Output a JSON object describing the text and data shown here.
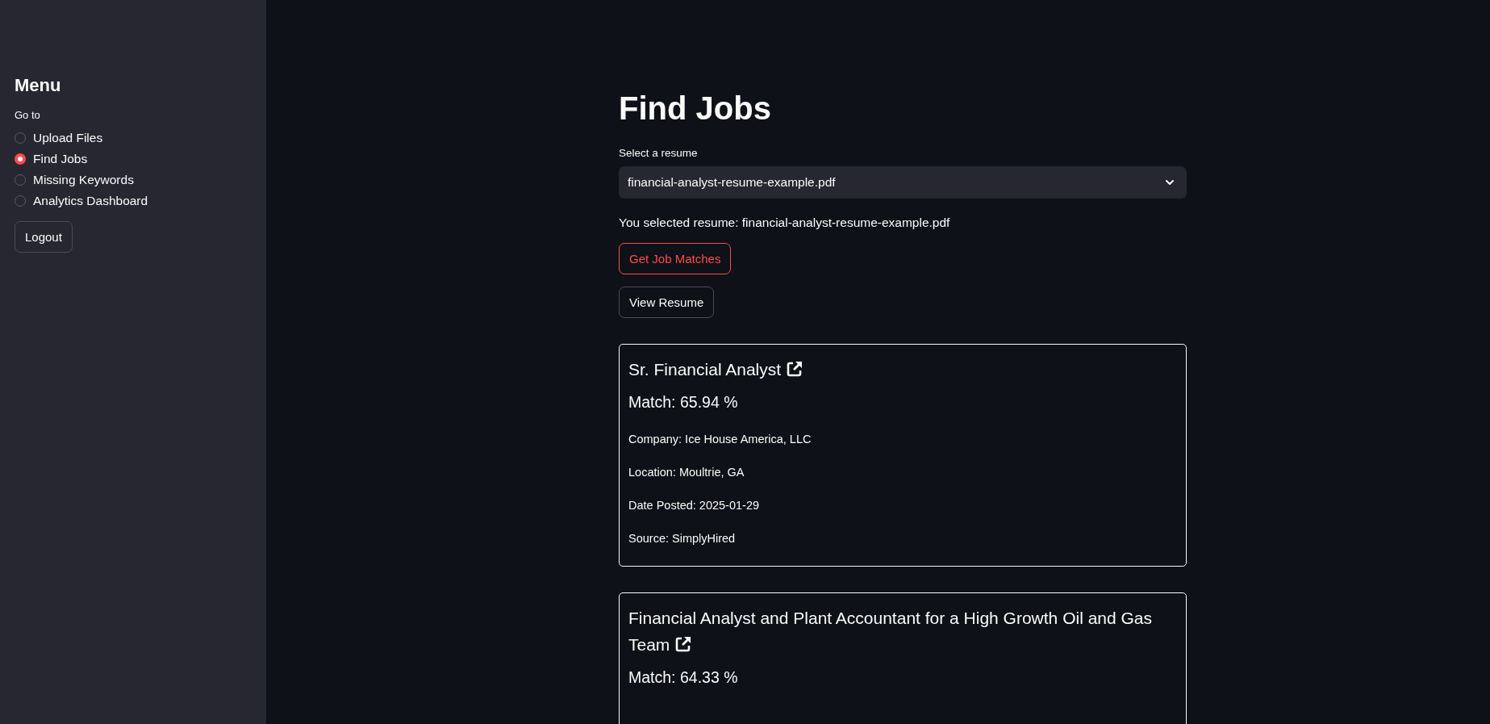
{
  "sidebar": {
    "title": "Menu",
    "nav_label": "Go to",
    "items": [
      {
        "label": "Upload Files",
        "selected": false
      },
      {
        "label": "Find Jobs",
        "selected": true
      },
      {
        "label": "Missing Keywords",
        "selected": false
      },
      {
        "label": "Analytics Dashboard",
        "selected": false
      }
    ],
    "logout_button": "Logout"
  },
  "main": {
    "title": "Find Jobs",
    "select_label": "Select a resume",
    "select_value": "financial-analyst-resume-example.pdf",
    "selection_text": "You selected resume: financial-analyst-resume-example.pdf",
    "primary_button": "Get Job Matches",
    "secondary_button": "View Resume",
    "jobs": [
      {
        "title": "Sr. Financial Analyst",
        "match": "Match: 65.94 %",
        "details": [
          "Company: Ice House America, LLC",
          "Location: Moultrie, GA",
          "Date Posted: 2025-01-29",
          "Source: SimplyHired"
        ]
      },
      {
        "title": "Financial Analyst and Plant Accountant for a High Growth Oil and Gas Team",
        "match": "Match: 64.33 %"
      }
    ]
  }
}
